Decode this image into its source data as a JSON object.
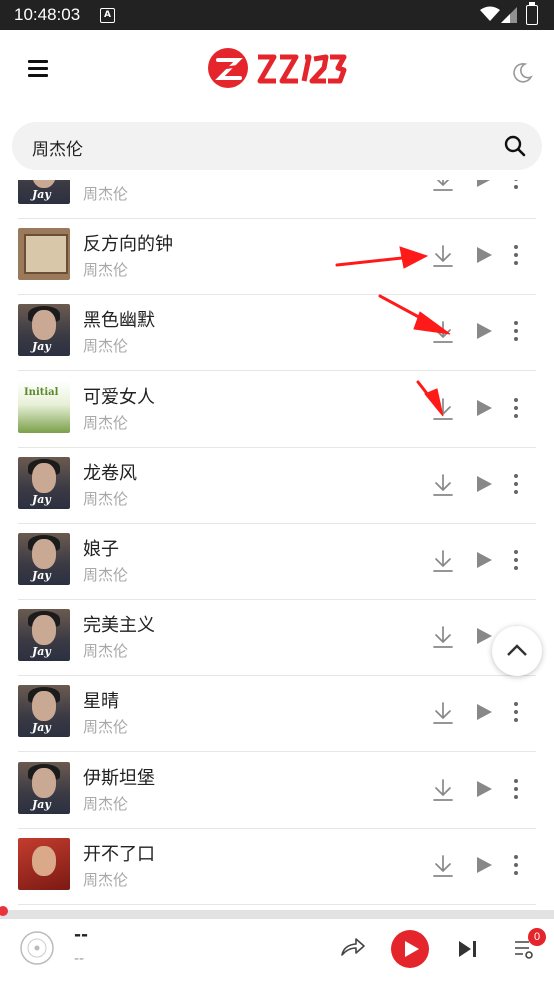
{
  "status_bar": {
    "time": "10:48:03",
    "notification_glyph": "A"
  },
  "header": {
    "logo_text": "ZZ123",
    "menu_icon": "hamburger-icon",
    "theme_icon": "moon-icon"
  },
  "search": {
    "value": "周杰伦"
  },
  "songs": [
    {
      "title": "",
      "artist": "周杰伦",
      "cover": "jay"
    },
    {
      "title": "反方向的钟",
      "artist": "周杰伦",
      "cover": "clock"
    },
    {
      "title": "黑色幽默",
      "artist": "周杰伦",
      "cover": "jay"
    },
    {
      "title": "可爱女人",
      "artist": "周杰伦",
      "cover": "initial",
      "cover_text": "Initial"
    },
    {
      "title": "龙卷风",
      "artist": "周杰伦",
      "cover": "jay"
    },
    {
      "title": "娘子",
      "artist": "周杰伦",
      "cover": "jay"
    },
    {
      "title": "完美主义",
      "artist": "周杰伦",
      "cover": "jay"
    },
    {
      "title": "星晴",
      "artist": "周杰伦",
      "cover": "jay"
    },
    {
      "title": "伊斯坦堡",
      "artist": "周杰伦",
      "cover": "jay"
    },
    {
      "title": "开不了口",
      "artist": "周杰伦",
      "cover": "red"
    }
  ],
  "cover_text_jay": "Jay",
  "player": {
    "title": "--",
    "subtitle": "--",
    "queue_count": "0"
  },
  "colors": {
    "accent": "#e4262c",
    "arrow": "#ff1a1a"
  }
}
